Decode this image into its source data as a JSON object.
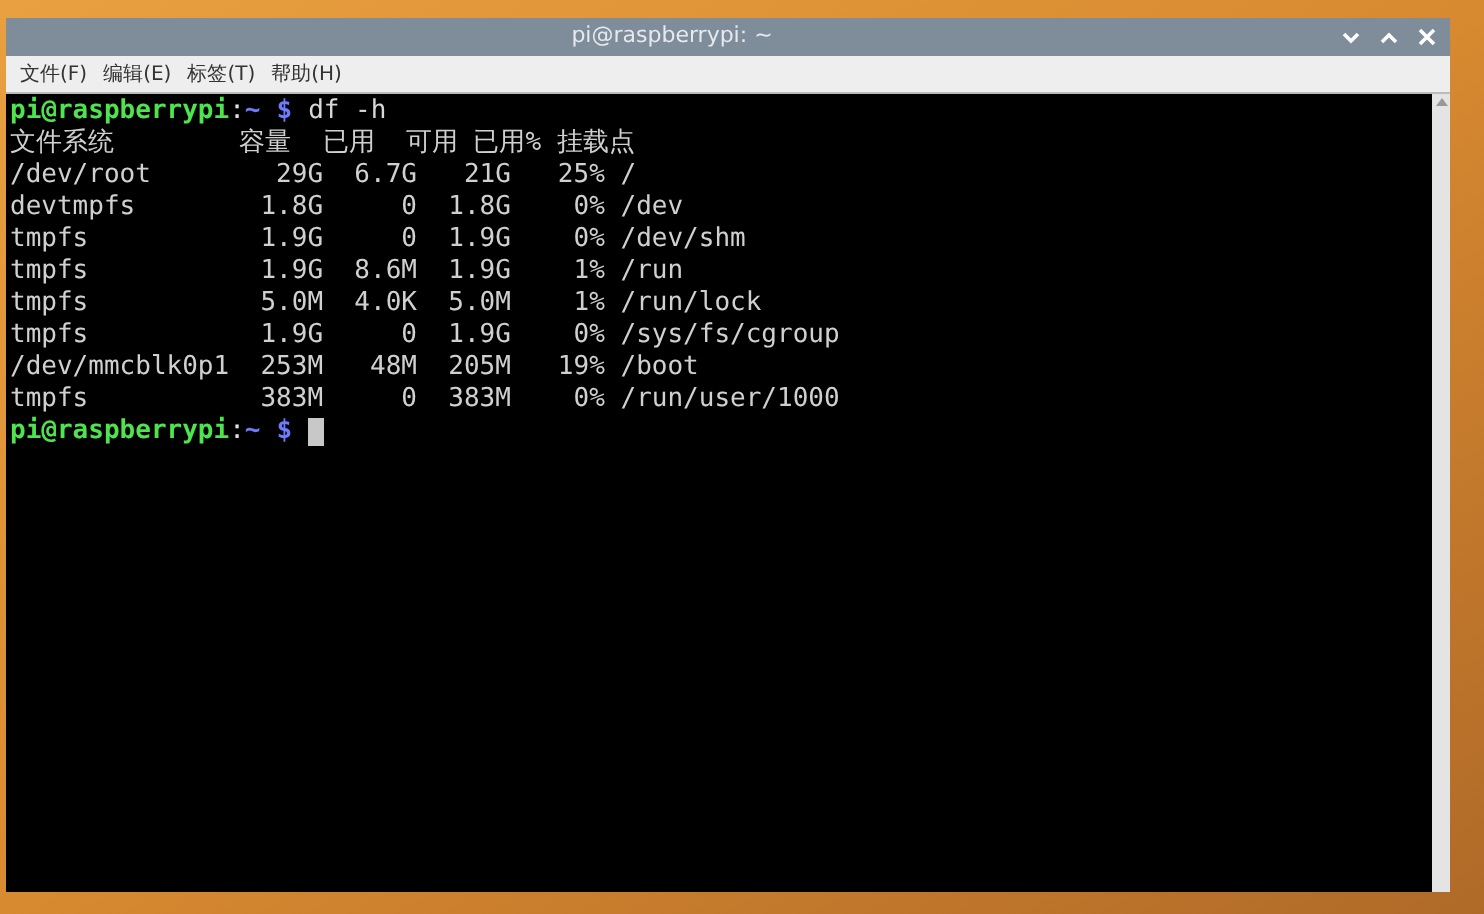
{
  "window": {
    "title": "pi@raspberrypi: ~"
  },
  "menu": [
    "文件(F)",
    "编辑(E)",
    "标签(T)",
    "帮助(H)"
  ],
  "terminal": {
    "lines": [
      {
        "kind": "prompt",
        "user_host": "pi@raspberrypi",
        "separator": ":",
        "path": "~",
        "symbol": "$",
        "command": "df -h",
        "cursor": false
      },
      {
        "kind": "output",
        "text": "文件系统        容量  已用  可用 已用% 挂载点"
      },
      {
        "kind": "output",
        "text": "/dev/root        29G  6.7G   21G   25% /"
      },
      {
        "kind": "output",
        "text": "devtmpfs        1.8G     0  1.8G    0% /dev"
      },
      {
        "kind": "output",
        "text": "tmpfs           1.9G     0  1.9G    0% /dev/shm"
      },
      {
        "kind": "output",
        "text": "tmpfs           1.9G  8.6M  1.9G    1% /run"
      },
      {
        "kind": "output",
        "text": "tmpfs           5.0M  4.0K  5.0M    1% /run/lock"
      },
      {
        "kind": "output",
        "text": "tmpfs           1.9G     0  1.9G    0% /sys/fs/cgroup"
      },
      {
        "kind": "output",
        "text": "/dev/mmcblk0p1  253M   48M  205M   19% /boot"
      },
      {
        "kind": "output",
        "text": "tmpfs           383M     0  383M    0% /run/user/1000"
      },
      {
        "kind": "prompt",
        "user_host": "pi@raspberrypi",
        "separator": ":",
        "path": "~",
        "symbol": "$",
        "cursor": true
      }
    ]
  }
}
